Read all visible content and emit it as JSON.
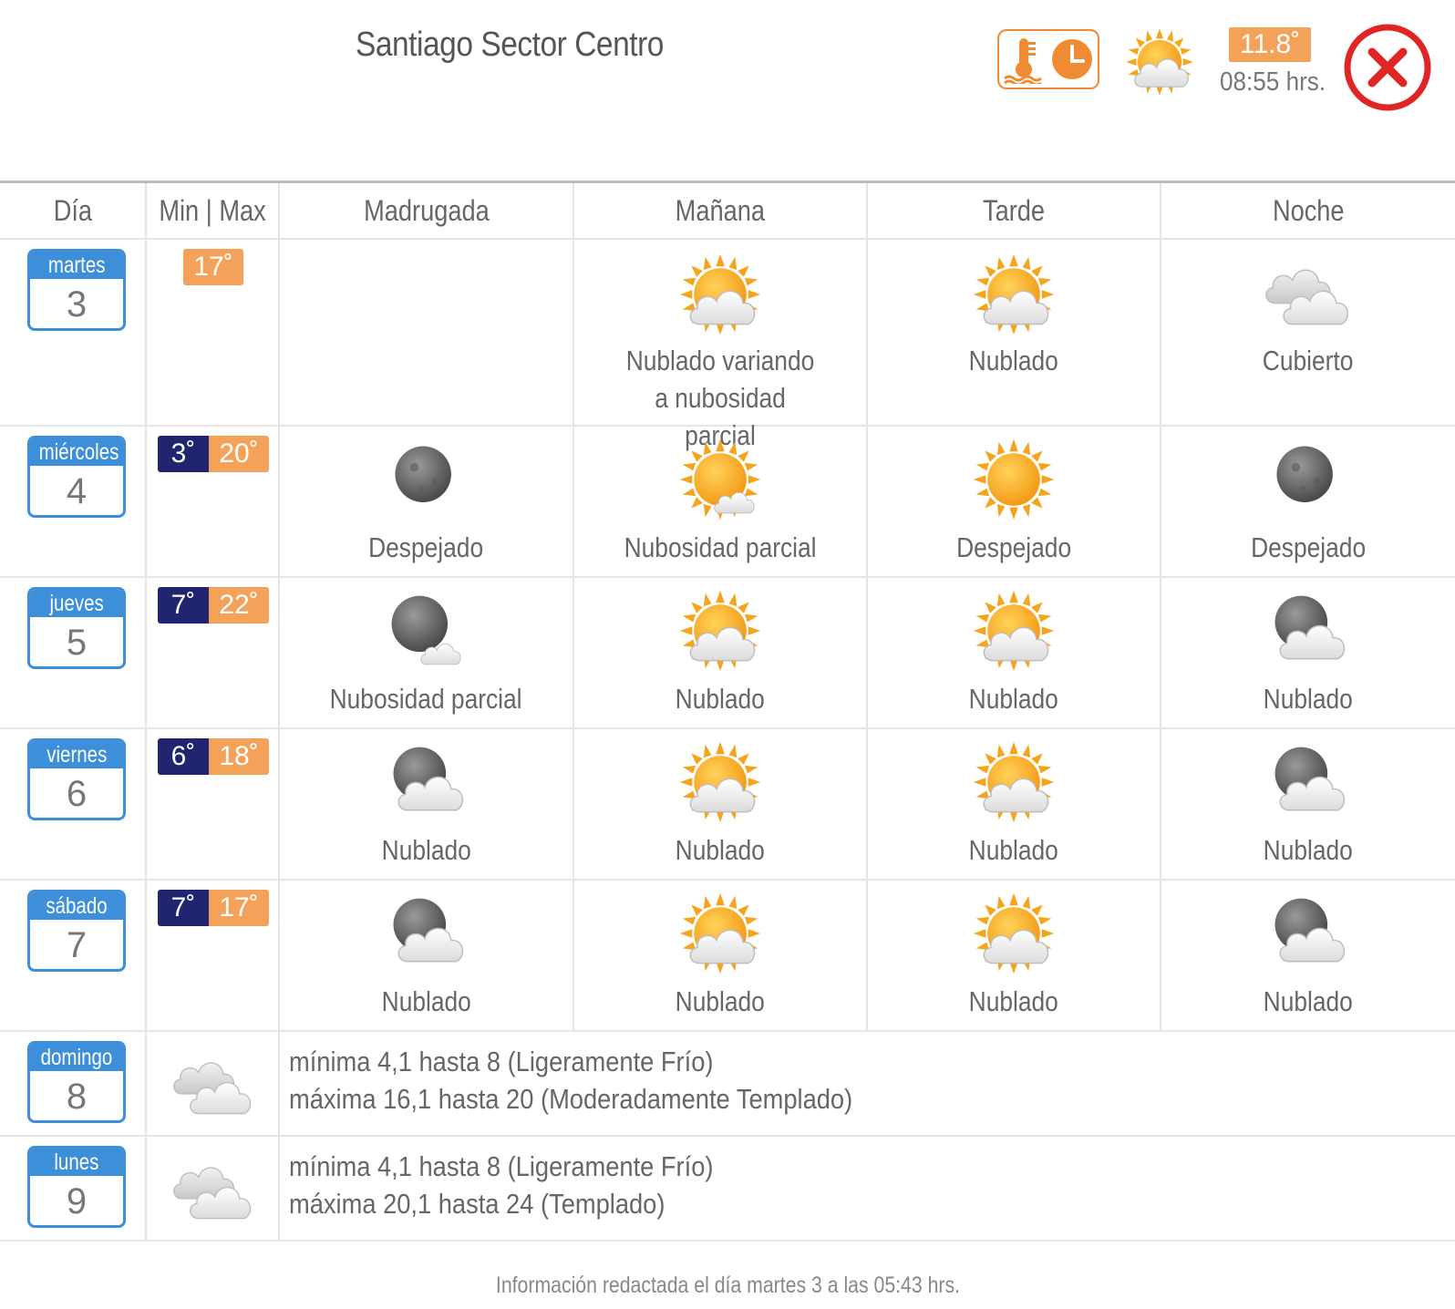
{
  "header": {
    "title": "Santiago Sector Centro",
    "current_temp": "11.8˚",
    "current_time": "08:55 hrs.",
    "current_icon": "partly-cloudy-icon",
    "station_icon": "thermometer-clock-icon",
    "close_icon": "close-icon"
  },
  "table": {
    "columns": [
      "Día",
      "Min | Max",
      "Madrugada",
      "Mañana",
      "Tarde",
      "Noche"
    ],
    "days": [
      {
        "weekday": "martes",
        "day": "3",
        "min": "",
        "max": "17˚",
        "periods": [
          {
            "icon": "",
            "desc": ""
          },
          {
            "icon": "sun-cloud-icon",
            "desc": "Nublado variando a nubosidad parcial"
          },
          {
            "icon": "sun-cloud-icon",
            "desc": "Nublado"
          },
          {
            "icon": "overcast-icon",
            "desc": "Cubierto"
          }
        ]
      },
      {
        "weekday": "miércoles",
        "day": "4",
        "min": "3˚",
        "max": "20˚",
        "periods": [
          {
            "icon": "moon-icon",
            "desc": "Despejado"
          },
          {
            "icon": "sun-small-cloud-icon",
            "desc": "Nubosidad parcial"
          },
          {
            "icon": "sun-icon",
            "desc": "Despejado"
          },
          {
            "icon": "moon-icon",
            "desc": "Despejado"
          }
        ]
      },
      {
        "weekday": "jueves",
        "day": "5",
        "min": "7˚",
        "max": "22˚",
        "periods": [
          {
            "icon": "moon-small-cloud-icon",
            "desc": "Nubosidad parcial"
          },
          {
            "icon": "sun-cloud-icon",
            "desc": "Nublado"
          },
          {
            "icon": "sun-cloud-icon",
            "desc": "Nublado"
          },
          {
            "icon": "moon-cloud-icon",
            "desc": "Nublado"
          }
        ]
      },
      {
        "weekday": "viernes",
        "day": "6",
        "min": "6˚",
        "max": "18˚",
        "periods": [
          {
            "icon": "moon-cloud-icon",
            "desc": "Nublado"
          },
          {
            "icon": "sun-cloud-icon",
            "desc": "Nublado"
          },
          {
            "icon": "sun-cloud-icon",
            "desc": "Nublado"
          },
          {
            "icon": "moon-cloud-icon",
            "desc": "Nublado"
          }
        ]
      },
      {
        "weekday": "sábado",
        "day": "7",
        "min": "7˚",
        "max": "17˚",
        "periods": [
          {
            "icon": "moon-cloud-icon",
            "desc": "Nublado"
          },
          {
            "icon": "sun-cloud-icon",
            "desc": "Nublado"
          },
          {
            "icon": "sun-cloud-icon",
            "desc": "Nublado"
          },
          {
            "icon": "moon-cloud-icon",
            "desc": "Nublado"
          }
        ]
      }
    ],
    "extended": [
      {
        "weekday": "domingo",
        "day": "8",
        "icon": "overcast-icon",
        "line1": "mínima 4,1 hasta 8 (Ligeramente Frío)",
        "line2": "máxima 16,1 hasta 20 (Moderadamente Templado)"
      },
      {
        "weekday": "lunes",
        "day": "9",
        "icon": "overcast-icon",
        "line1": "mínima 4,1 hasta 8 (Ligeramente Frío)",
        "line2": "máxima 20,1 hasta 24 (Templado)"
      }
    ]
  },
  "footer": {
    "note": "Información redactada el día martes 3 a las 05:43 hrs."
  },
  "colors": {
    "calendar_blue": "#3c8fd8",
    "max_orange": "#f4a25a",
    "min_navy": "#21246e",
    "close_red": "#e02525"
  }
}
